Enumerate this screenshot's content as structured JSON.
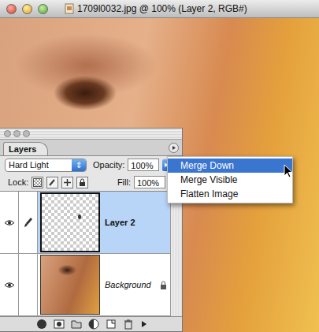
{
  "window": {
    "title": "1709l0032.jpg @ 100% (Layer 2, RGB#)"
  },
  "layers_palette": {
    "tab": "Layers",
    "blend_mode": "Hard Light",
    "opacity_label": "Opacity:",
    "opacity": "100%",
    "lock_label": "Lock:",
    "fill_label": "Fill:",
    "fill": "100%",
    "layers": [
      {
        "name": "Layer 2",
        "selected": true,
        "visible": true,
        "locked": false,
        "brush": true,
        "kind": "transparent"
      },
      {
        "name": "Background",
        "selected": false,
        "visible": true,
        "locked": true,
        "brush": false,
        "kind": "photo"
      }
    ]
  },
  "menu": {
    "items": [
      {
        "label": "Merge Down",
        "selected": true
      },
      {
        "label": "Merge Visible",
        "selected": false
      },
      {
        "label": "Flatten Image",
        "selected": false
      }
    ]
  }
}
